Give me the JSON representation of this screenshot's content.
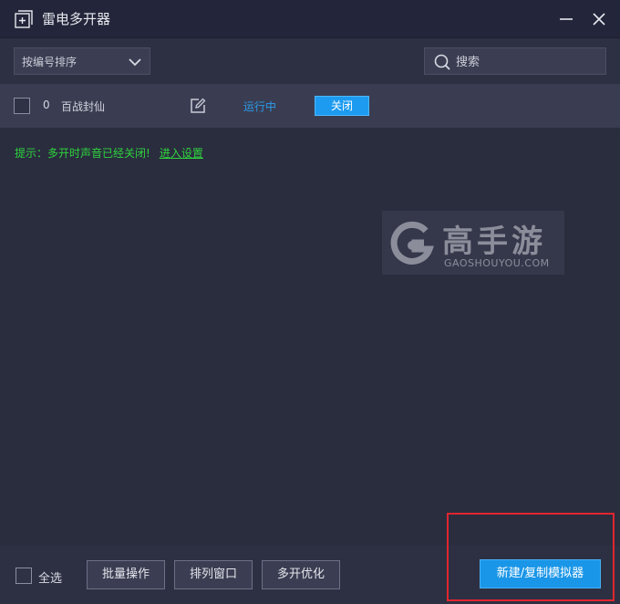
{
  "window": {
    "title": "雷电多开器",
    "icons": {
      "app": "add-window-icon",
      "minimize": "minimize-icon",
      "close": "close-icon"
    }
  },
  "toolbar": {
    "sort_selected": "按编号排序",
    "search_placeholder": "搜索"
  },
  "instances": [
    {
      "index": "0",
      "name": "百战封仙",
      "status": "运行中",
      "action_label": "关闭",
      "status_color": "#2c9bea"
    }
  ],
  "tip": {
    "text": "提示：多开时声音已经关闭!",
    "link": "进入设置",
    "color": "#2ed23d"
  },
  "watermark": {
    "brand_cn": "高手游",
    "brand_en": "GAOSHOUYOU.COM"
  },
  "footer": {
    "select_all_label": "全选",
    "batch_label": "批量操作",
    "arrange_label": "排列窗口",
    "optimize_label": "多开优化",
    "create_label": "新建/复制模拟器"
  },
  "colors": {
    "accent": "#1a96e8",
    "highlight": "#e0252f",
    "background": "#2a2d3e"
  }
}
